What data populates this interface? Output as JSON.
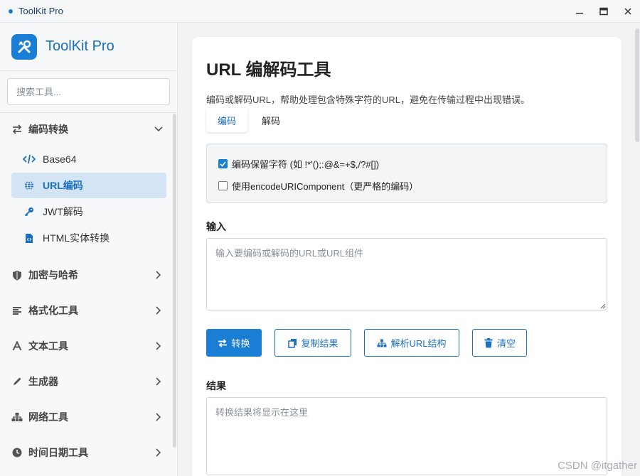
{
  "window": {
    "title": "ToolKit Pro"
  },
  "sidebar": {
    "brand": "ToolKit Pro",
    "search_placeholder": "搜索工具...",
    "groups": [
      {
        "label": "编码转换",
        "icon": "arrows-exchange-icon",
        "expanded": true,
        "items": [
          {
            "label": "Base64",
            "icon": "code-icon",
            "active": false
          },
          {
            "label": "URL编码",
            "icon": "globe-icon",
            "active": true
          },
          {
            "label": "JWT解码",
            "icon": "key-icon",
            "active": false
          },
          {
            "label": "HTML实体转换",
            "icon": "file-code-icon",
            "active": false
          }
        ]
      },
      {
        "label": "加密与哈希",
        "icon": "shield-icon",
        "expanded": false
      },
      {
        "label": "格式化工具",
        "icon": "align-left-icon",
        "expanded": false
      },
      {
        "label": "文本工具",
        "icon": "font-icon",
        "expanded": false
      },
      {
        "label": "生成器",
        "icon": "pen-icon",
        "expanded": false
      },
      {
        "label": "网络工具",
        "icon": "sitemap-icon",
        "expanded": false
      },
      {
        "label": "时间日期工具",
        "icon": "clock-icon",
        "expanded": false
      }
    ]
  },
  "main": {
    "title": "URL 编解码工具",
    "description": "编码或解码URL，帮助处理包含特殊字符的URL，避免在传输过程中出现错误。",
    "tabs": [
      {
        "label": "编码",
        "active": true
      },
      {
        "label": "解码",
        "active": false
      }
    ],
    "options": [
      {
        "label": "编码保留字符 (如 !*'();:@&=+$,/?#[])",
        "checked": true
      },
      {
        "label": "使用encodeURIComponent（更严格的编码）",
        "checked": false
      }
    ],
    "input": {
      "label": "输入",
      "placeholder": "输入要编码或解码的URL或URL组件",
      "value": ""
    },
    "buttons": {
      "convert": "转换",
      "copy": "复制结果",
      "parse": "解析URL结构",
      "clear": "清空"
    },
    "result": {
      "label": "结果",
      "placeholder": "转换结果将显示在这里",
      "value": ""
    }
  },
  "watermark": "CSDN @itgather",
  "colors": {
    "accent": "#1a7fd4",
    "active_bg": "#d3e5f5"
  }
}
